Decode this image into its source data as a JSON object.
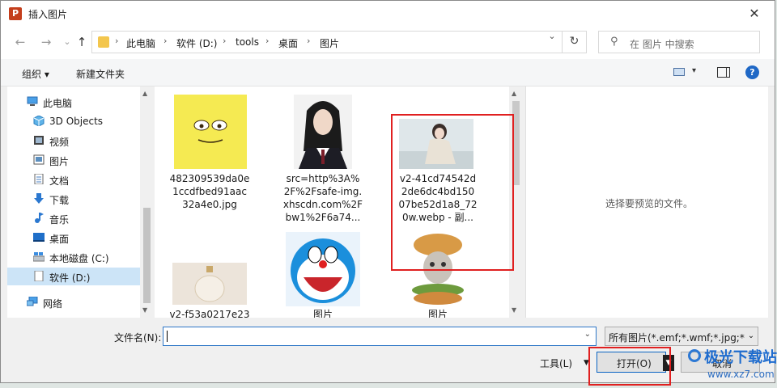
{
  "window": {
    "title": "插入图片",
    "app_icon_letter": "P",
    "close_glyph": "✕"
  },
  "nav": {
    "back_glyph": "←",
    "forward_glyph": "→",
    "history_glyph": "⌄",
    "up_glyph": "↑",
    "breadcrumbs": [
      "此电脑",
      "软件 (D:)",
      "tools",
      "桌面",
      "图片"
    ],
    "separator": "›",
    "refresh_glyph": "↻",
    "search_placeholder": "在 图片 中搜索",
    "search_glyph": "⚲"
  },
  "toolbar": {
    "organize_label": "组织 ▾",
    "new_folder_label": "新建文件夹",
    "help_glyph": "?"
  },
  "sidebar": {
    "items": [
      {
        "label": "此电脑",
        "icon": "computer-icon"
      },
      {
        "label": "3D Objects",
        "icon": "cube-icon"
      },
      {
        "label": "视频",
        "icon": "video-icon"
      },
      {
        "label": "图片",
        "icon": "pictures-icon"
      },
      {
        "label": "文档",
        "icon": "document-icon"
      },
      {
        "label": "下载",
        "icon": "download-icon"
      },
      {
        "label": "音乐",
        "icon": "music-icon"
      },
      {
        "label": "桌面",
        "icon": "desktop-icon"
      },
      {
        "label": "本地磁盘 (C:)",
        "icon": "drive-icon"
      },
      {
        "label": "软件 (D:)",
        "icon": "drive-icon",
        "selected": true
      },
      {
        "label": "网络",
        "icon": "network-icon"
      }
    ]
  },
  "files": [
    {
      "name": "482309539da0e1ccdfbed91aac32a4e0.jpg",
      "lines": [
        "482309539da0e",
        "1ccdfbed91aac",
        "32a4e0.jpg"
      ],
      "thumb": "spongebob"
    },
    {
      "name": "src=http%3A%2F%2Fsafe-img.xhscdn.com%2Fbw1%2F6a74...",
      "lines": [
        "src=http%3A%",
        "2F%2Fsafe-img.",
        "xhscdn.com%2F",
        "bw1%2F6a74..."
      ],
      "thumb": "portrait"
    },
    {
      "name": "v2-41cd74542d2de6dc4bd15007be52d1a8_720w.webp - 副...",
      "lines": [
        "v2-41cd74542d",
        "2de6dc4bd150",
        "07be52d1a8_72",
        "0w.webp - 副..."
      ],
      "thumb": "woman-photo"
    },
    {
      "name": "v2-f53a0217e23",
      "lines": [
        "v2-f53a0217e23"
      ],
      "thumb": "perfume-bottle"
    },
    {
      "name": "图片",
      "lines": [
        "图片"
      ],
      "thumb": "doraemon"
    },
    {
      "name": "图片",
      "lines": [
        "图片"
      ],
      "thumb": "cat-burger"
    }
  ],
  "preview": {
    "placeholder": "选择要预览的文件。"
  },
  "bottom": {
    "filename_label": "文件名(N):",
    "filename_value": "",
    "filetype_value": "所有图片(*.emf;*.wmf;*.jpg;*.jp",
    "tools_label": "工具(L)",
    "open_label": "打开(O)",
    "cancel_label": "取消"
  },
  "watermark": {
    "text": "极光下载站",
    "url": "www.xz7.com"
  },
  "colors": {
    "accent": "#0b64c3",
    "highlight": "#e02020",
    "selected": "#cce4f7"
  }
}
